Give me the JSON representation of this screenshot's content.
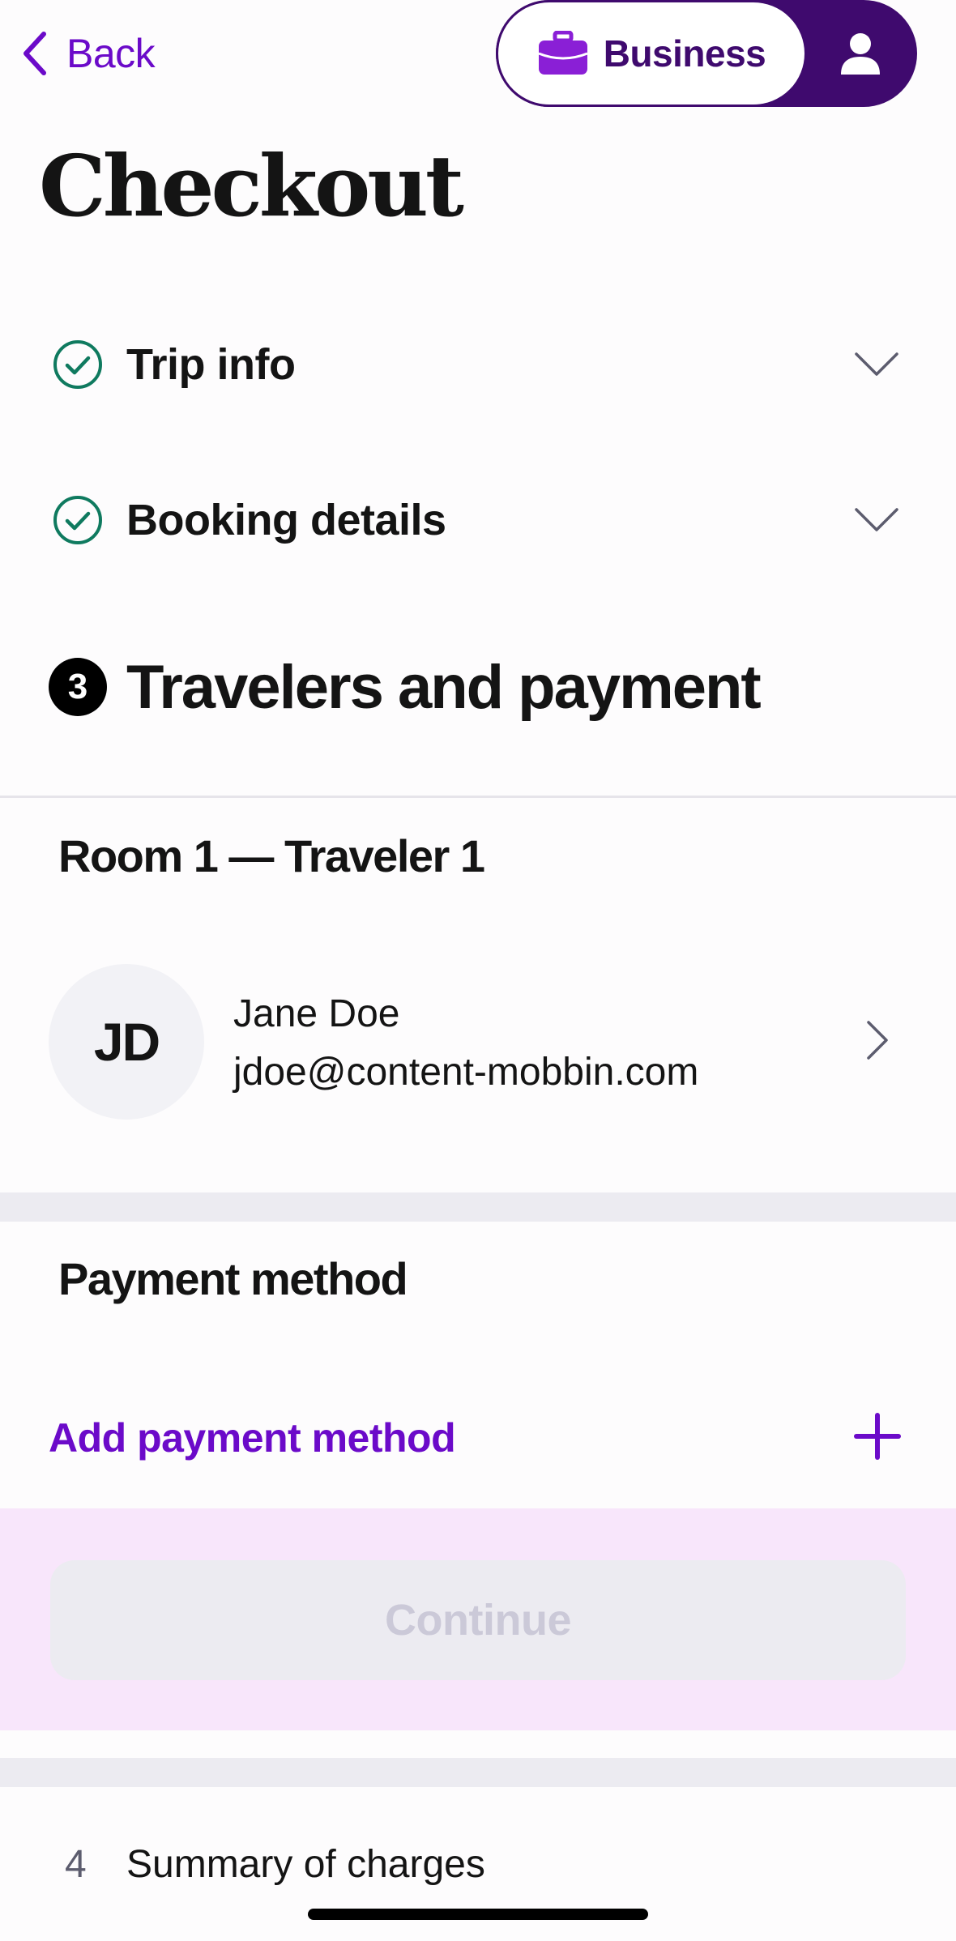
{
  "header": {
    "back_label": "Back",
    "business_label": "Business",
    "icons": {
      "back": "chevron-left-icon",
      "business": "briefcase-icon",
      "user": "user-icon"
    }
  },
  "page": {
    "title": "Checkout"
  },
  "steps": [
    {
      "label": "Trip info",
      "status": "complete"
    },
    {
      "label": "Booking details",
      "status": "complete"
    }
  ],
  "current_step": {
    "number": "3",
    "label": "Travelers and payment"
  },
  "travelers": {
    "heading": "Room 1 — Traveler 1",
    "initials": "JD",
    "name": "Jane Doe",
    "email": "jdoe@content-mobbin.com"
  },
  "payment": {
    "heading": "Payment method",
    "add_label": "Add payment method"
  },
  "cta": {
    "label": "Continue",
    "enabled": false
  },
  "next_step": {
    "number": "4",
    "label": "Summary of charges"
  },
  "colors": {
    "accent": "#6b0ac9",
    "brand_dark": "#3f0a6e",
    "success": "#0f7a5f",
    "cta_area": "#f8e6fb",
    "disabled_bg": "#ecebf1",
    "disabled_text": "#cbc9d8"
  }
}
